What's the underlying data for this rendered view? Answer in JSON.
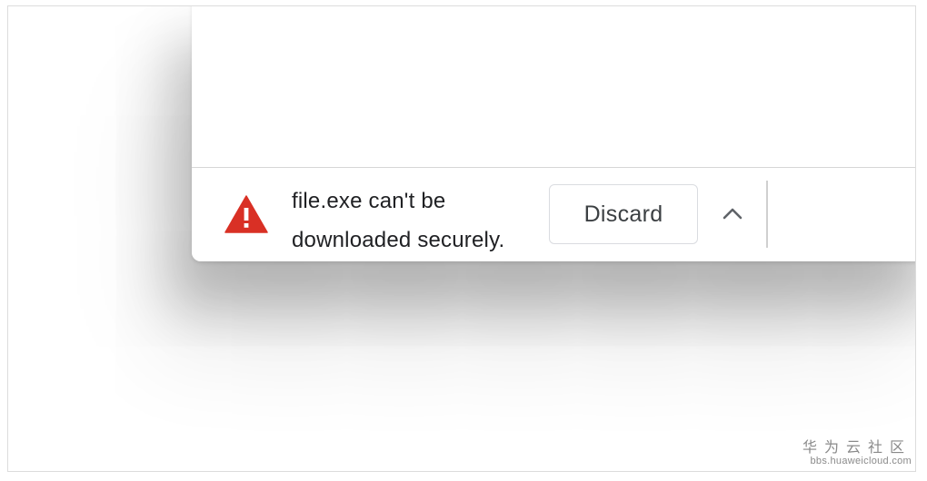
{
  "download_shelf": {
    "warning": {
      "line1": "file.exe can't be",
      "line2": "downloaded securely."
    },
    "discard_label": "Discard",
    "expand_icon": "chevron-up-icon",
    "warning_icon": "warning-triangle-icon"
  },
  "watermark": {
    "brand": "华为云社区",
    "url": "bbs.huaweicloud.com"
  },
  "colors": {
    "warning_red": "#d93025",
    "text": "#202124",
    "button_border": "#dadce0",
    "chevron": "#5f6368"
  }
}
